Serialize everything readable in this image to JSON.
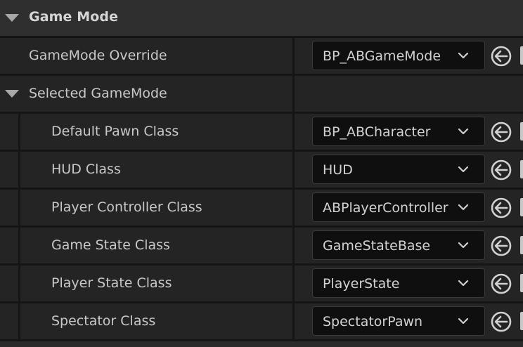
{
  "section": {
    "title": "Game Mode"
  },
  "override": {
    "label": "GameMode Override",
    "value": "BP_ABGameMode"
  },
  "selected": {
    "label": "Selected GameMode",
    "properties": [
      {
        "label": "Default Pawn Class",
        "value": "BP_ABCharacter"
      },
      {
        "label": "HUD Class",
        "value": "HUD"
      },
      {
        "label": "Player Controller Class",
        "value": "ABPlayerController"
      },
      {
        "label": "Game State Class",
        "value": "GameStateBase"
      },
      {
        "label": "Player State Class",
        "value": "PlayerState"
      },
      {
        "label": "Spectator Class",
        "value": "SpectatorPawn"
      }
    ]
  },
  "icons": {
    "expand": "caret-down-icon",
    "dropdown": "chevron-down-icon",
    "use_selected": "arrow-left-circle-icon",
    "browse": "browse-icon"
  },
  "colors": {
    "background": "#1e1e1e",
    "header": "#2f2f2f",
    "row": "#242424",
    "combo": "#0f0f0f",
    "text": "#c8c8c8"
  }
}
